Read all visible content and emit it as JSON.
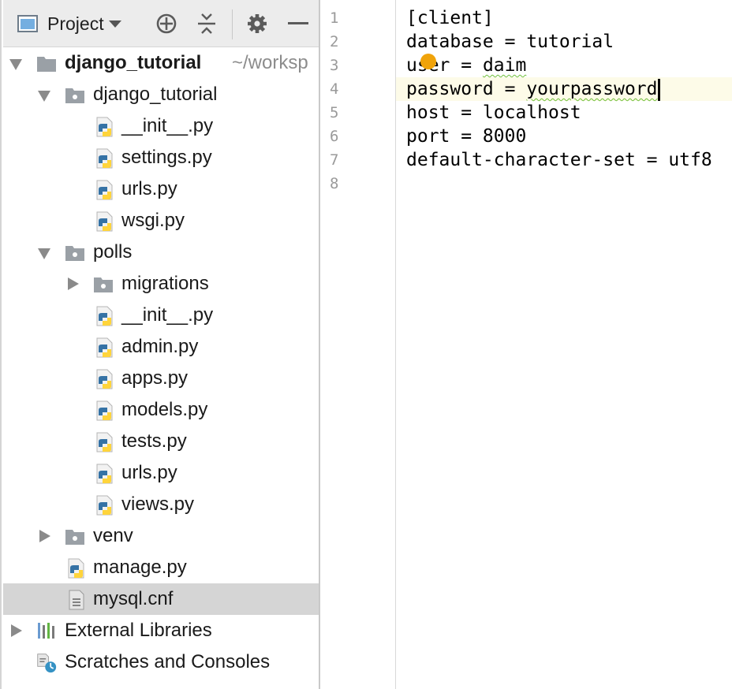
{
  "toolbar": {
    "view_selector_label": "Project",
    "icons": [
      "project-view-icon",
      "locate-icon",
      "collapse-all-icon",
      "gear-icon",
      "hide-icon"
    ]
  },
  "tree": {
    "root": {
      "label": "django_tutorial",
      "path": "~/worksp"
    },
    "pkg_django": {
      "label": "django_tutorial"
    },
    "f_init1": {
      "label": "__init__.py"
    },
    "f_settings": {
      "label": "settings.py"
    },
    "f_urls1": {
      "label": "urls.py"
    },
    "f_wsgi": {
      "label": "wsgi.py"
    },
    "pkg_polls": {
      "label": "polls"
    },
    "dir_migrations": {
      "label": "migrations"
    },
    "f_init2": {
      "label": "__init__.py"
    },
    "f_admin": {
      "label": "admin.py"
    },
    "f_apps": {
      "label": "apps.py"
    },
    "f_models": {
      "label": "models.py"
    },
    "f_tests": {
      "label": "tests.py"
    },
    "f_urls2": {
      "label": "urls.py"
    },
    "f_views": {
      "label": "views.py"
    },
    "dir_venv": {
      "label": "venv"
    },
    "f_manage": {
      "label": "manage.py"
    },
    "f_mysql": {
      "label": "mysql.cnf"
    },
    "ext_libs": {
      "label": "External Libraries"
    },
    "scratches": {
      "label": "Scratches and Consoles"
    }
  },
  "editor": {
    "line_numbers": [
      "1",
      "2",
      "3",
      "4",
      "5",
      "6",
      "7",
      "8"
    ],
    "lines": {
      "l1": "[client]",
      "l2": "database = tutorial",
      "l3a": "user = ",
      "l3b": "daim",
      "l4a": "password = ",
      "l4b": "yourpassword",
      "l5": "host = localhost",
      "l6": "port = 8000",
      "l7": "default-character-set = utf8"
    },
    "current_line": "4"
  },
  "colors": {
    "selection_bg": "#d5d5d5",
    "caret_line_bg": "#fdfbe8",
    "folder_icon": "#9aa0a6",
    "python_blue": "#3572a5",
    "python_yellow": "#ffd43b",
    "spellcheck_squiggle": "#6fbf3a",
    "intention_bulb": "#f0a30a"
  }
}
